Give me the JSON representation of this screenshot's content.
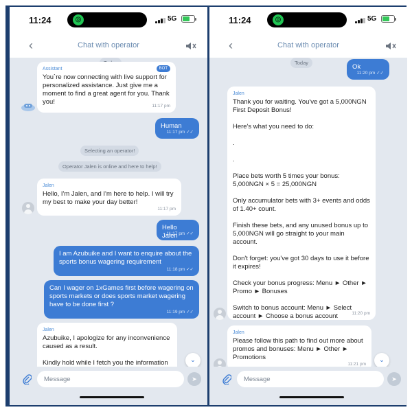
{
  "status_bar": {
    "time": "11:24",
    "network": "5G"
  },
  "header": {
    "title": "Chat with operator"
  },
  "composer": {
    "placeholder": "Message"
  },
  "left": {
    "date_chip": "Today",
    "assistant": {
      "sender": "Assistant",
      "badge": "BOT",
      "text": "You`re now connecting with live support for personalized assistance. Just give me a moment to find a great agent for you. Thank you!",
      "time": "11:17 pm"
    },
    "human": {
      "text": "Human",
      "time": "11:17 pm ✓✓"
    },
    "selecting_chip": "Selecting an operator!",
    "online_chip": "Operator Jalen is online and here to help!",
    "jalen_intro": {
      "sender": "Jalen",
      "text": "Hello, I'm Jalen, and I'm here to help. I will try my best to make your day better!",
      "time": "11:17 pm"
    },
    "hello": {
      "text": "Hello Jalen",
      "time": "11:17 pm ✓✓"
    },
    "enquire": {
      "text": "I am Azubuike and I want to enquire about the sports bonus wagering requirement",
      "time": "11:18 pm ✓✓"
    },
    "question": {
      "text": "Can I wager on 1xGames first before wagering on sports markets or does sports market wagering have to be done first ?",
      "time": "11:19 pm ✓✓"
    },
    "apology": {
      "sender": "Jalen",
      "text": "Azubuike, I apologize for any inconvenience caused as a result.\n\nKindly hold while I fetch you the information you've requested."
    }
  },
  "right": {
    "date_chip": "Today",
    "ok": {
      "text": "Ok",
      "time": "11:20 pm ✓✓"
    },
    "bonus_info": {
      "sender": "Jalen",
      "text": "Thank you for waiting. You've got a 5,000NGN First Deposit Bonus!\n\nHere's what you need to do:\n\n.\n\n.\n\nPlace bets worth 5 times your bonus:\n5,000NGN × 5 = 25,000NGN\n\nOnly accumulator bets with 3+ events and odds of 1.40+ count.\n\nFinish these bets, and any unused bonus up to 5,000NGN will go straight to your main account.\n\nDon't forget: you've got 30 days to use it before it expires!\n\nCheck your bonus progress: Menu ► Other ► Promo ► Bonuses\n\nSwitch to bonus account: Menu ► Select account ► Choose a bonus account",
      "time": "11:20 pm"
    },
    "path_info": {
      "sender": "Jalen",
      "text": "Please follow this path to find out more about promos and bonuses: Menu ► Other ► Promotions",
      "time": "11:21 pm"
    }
  },
  "icons": {
    "back": "chevron-left-icon",
    "speaker": "speaker-mute-icon",
    "attach": "paperclip-icon",
    "send": "send-icon",
    "scroll": "chevron-down-icon"
  },
  "colors": {
    "frame": "#1d3e6e",
    "outgoing_bubble": "#3d7cd4",
    "incoming_bubble": "#ffffff",
    "chat_background": "#e3e8ef",
    "sender_name": "#4a8bd6"
  }
}
